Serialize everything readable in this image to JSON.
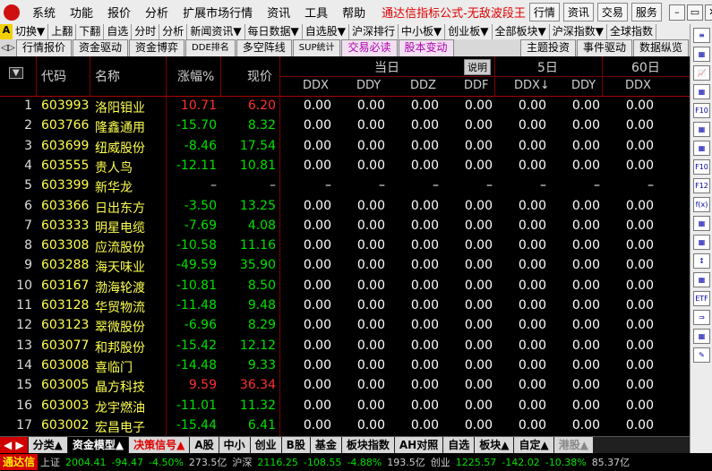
{
  "menubar": {
    "items": [
      "系统",
      "功能",
      "报价",
      "分析",
      "扩展市场行情",
      "资讯",
      "工具",
      "帮助"
    ],
    "title": "通达信指标公式-无敌波段王",
    "buttons": [
      "行情",
      "资讯",
      "交易",
      "服务"
    ]
  },
  "toolbar": {
    "badge": "A",
    "items": [
      "切换▼",
      "上翻",
      "下翻",
      "自选",
      "分时",
      "分析",
      "新闻资讯▼",
      "每日数据▼",
      "自选股▼",
      "沪深排行",
      "中小板▼",
      "创业板▼",
      "全部板块▼",
      "沪深指数▼",
      "全球指数"
    ]
  },
  "tabbar": {
    "icon": "◁▷",
    "tabs": [
      "行情报价",
      "资金驱动",
      "资金博弈",
      "DDE排名",
      "多空阵线",
      "SUP统计",
      "交易必读",
      "股本变动",
      "主题投资",
      "事件驱动",
      "数据纵览"
    ]
  },
  "grid": {
    "headers": {
      "sort": "▼",
      "code": "代码",
      "name": "名称",
      "chg": "涨幅%",
      "price": "现价",
      "group_today": "当日",
      "explain": "说明",
      "group_5d": "5日",
      "group_60d": "60日",
      "ddx": "DDX",
      "ddy": "DDY",
      "ddz": "DDZ",
      "ddf": "DDF",
      "ddx5": "DDX↓",
      "ddy5": "DDY",
      "ddx60": "DDX"
    },
    "rows": [
      {
        "idx": "1",
        "code": "603993",
        "name": "洛阳钼业",
        "chg": "10.71",
        "price": "6.20",
        "d": [
          "0.00",
          "0.00",
          "0.00",
          "0.00",
          "0.00",
          "0.00",
          "0.00"
        ],
        "trend": "up"
      },
      {
        "idx": "2",
        "code": "603766",
        "name": "隆鑫通用",
        "chg": "-15.70",
        "price": "8.32",
        "d": [
          "0.00",
          "0.00",
          "0.00",
          "0.00",
          "0.00",
          "0.00",
          "0.00"
        ],
        "trend": "down"
      },
      {
        "idx": "3",
        "code": "603699",
        "name": "纽威股份",
        "chg": "-8.46",
        "price": "17.54",
        "d": [
          "0.00",
          "0.00",
          "0.00",
          "0.00",
          "0.00",
          "0.00",
          "0.00"
        ],
        "trend": "down"
      },
      {
        "idx": "4",
        "code": "603555",
        "name": "贵人鸟",
        "chg": "-12.11",
        "price": "10.81",
        "d": [
          "0.00",
          "0.00",
          "0.00",
          "0.00",
          "0.00",
          "0.00",
          "0.00"
        ],
        "trend": "down"
      },
      {
        "idx": "5",
        "code": "603399",
        "name": "新华龙",
        "chg": "–",
        "price": "–",
        "d": [
          "–",
          "–",
          "–",
          "–",
          "–",
          "–",
          "–"
        ],
        "trend": "flat"
      },
      {
        "idx": "6",
        "code": "603366",
        "name": "日出东方",
        "chg": "-3.50",
        "price": "13.25",
        "d": [
          "0.00",
          "0.00",
          "0.00",
          "0.00",
          "0.00",
          "0.00",
          "0.00"
        ],
        "trend": "down"
      },
      {
        "idx": "7",
        "code": "603333",
        "name": "明星电缆",
        "chg": "-7.69",
        "price": "4.08",
        "d": [
          "0.00",
          "0.00",
          "0.00",
          "0.00",
          "0.00",
          "0.00",
          "0.00"
        ],
        "trend": "down"
      },
      {
        "idx": "8",
        "code": "603308",
        "name": "应流股份",
        "chg": "-10.58",
        "price": "11.16",
        "d": [
          "0.00",
          "0.00",
          "0.00",
          "0.00",
          "0.00",
          "0.00",
          "0.00"
        ],
        "trend": "down"
      },
      {
        "idx": "9",
        "code": "603288",
        "name": "海天味业",
        "chg": "-49.59",
        "price": "35.90",
        "d": [
          "0.00",
          "0.00",
          "0.00",
          "0.00",
          "0.00",
          "0.00",
          "0.00"
        ],
        "trend": "down"
      },
      {
        "idx": "10",
        "code": "603167",
        "name": "渤海轮渡",
        "chg": "-10.81",
        "price": "8.50",
        "d": [
          "0.00",
          "0.00",
          "0.00",
          "0.00",
          "0.00",
          "0.00",
          "0.00"
        ],
        "trend": "down"
      },
      {
        "idx": "11",
        "code": "603128",
        "name": "华贸物流",
        "chg": "-11.48",
        "price": "9.48",
        "d": [
          "0.00",
          "0.00",
          "0.00",
          "0.00",
          "0.00",
          "0.00",
          "0.00"
        ],
        "trend": "down"
      },
      {
        "idx": "12",
        "code": "603123",
        "name": "翠微股份",
        "chg": "-6.96",
        "price": "8.29",
        "d": [
          "0.00",
          "0.00",
          "0.00",
          "0.00",
          "0.00",
          "0.00",
          "0.00"
        ],
        "trend": "down"
      },
      {
        "idx": "13",
        "code": "603077",
        "name": "和邦股份",
        "chg": "-15.42",
        "price": "12.12",
        "d": [
          "0.00",
          "0.00",
          "0.00",
          "0.00",
          "0.00",
          "0.00",
          "0.00"
        ],
        "trend": "down"
      },
      {
        "idx": "14",
        "code": "603008",
        "name": "喜临门",
        "chg": "-14.48",
        "price": "9.33",
        "d": [
          "0.00",
          "0.00",
          "0.00",
          "0.00",
          "0.00",
          "0.00",
          "0.00"
        ],
        "trend": "down"
      },
      {
        "idx": "15",
        "code": "603005",
        "name": "晶方科技",
        "chg": "9.59",
        "price": "36.34",
        "d": [
          "0.00",
          "0.00",
          "0.00",
          "0.00",
          "0.00",
          "0.00",
          "0.00"
        ],
        "trend": "up"
      },
      {
        "idx": "16",
        "code": "603003",
        "name": "龙宇燃油",
        "chg": "-11.01",
        "price": "11.32",
        "d": [
          "0.00",
          "0.00",
          "0.00",
          "0.00",
          "0.00",
          "0.00",
          "0.00"
        ],
        "trend": "down"
      },
      {
        "idx": "17",
        "code": "603002",
        "name": "宏昌电子",
        "chg": "-15.44",
        "price": "6.41",
        "d": [
          "0.00",
          "0.00",
          "0.00",
          "0.00",
          "0.00",
          "0.00",
          "0.00"
        ],
        "trend": "down"
      }
    ]
  },
  "bottomtabs": {
    "arrows": "◀ ▶",
    "tabs": [
      "分类▲",
      "资金模型▲",
      "决策信号▲",
      "A股",
      "中小",
      "创业",
      "B股",
      "基金",
      "板块指数",
      "AH对照",
      "自选",
      "板块▲",
      "自定▲",
      "港股▲"
    ]
  },
  "statusbar": {
    "logo": "通达信",
    "sh_label": "上证",
    "sh_value": "2004.41",
    "sh_chg": "-94.47",
    "sh_pct": "-4.50%",
    "sh_amt": "273.5亿",
    "hs_label": "沪深",
    "hs_value": "2116.25",
    "hs_chg": "-108.55",
    "hs_pct": "-4.88%",
    "hs_amt": "193.5亿",
    "cy_label": "创业",
    "cy_value": "1225.57",
    "cy_chg": "-142.02",
    "cy_pct": "-10.38%",
    "cy_amt": "85.37亿"
  },
  "sidebar": {
    "icons": [
      "≡",
      "▦",
      "📈",
      "▦",
      "F10",
      "▦",
      "▦",
      "F10",
      "F12",
      "f(x)",
      "▦",
      "▦",
      "↕",
      "▦",
      "ETF",
      "⇒",
      "▦",
      "✎"
    ]
  }
}
